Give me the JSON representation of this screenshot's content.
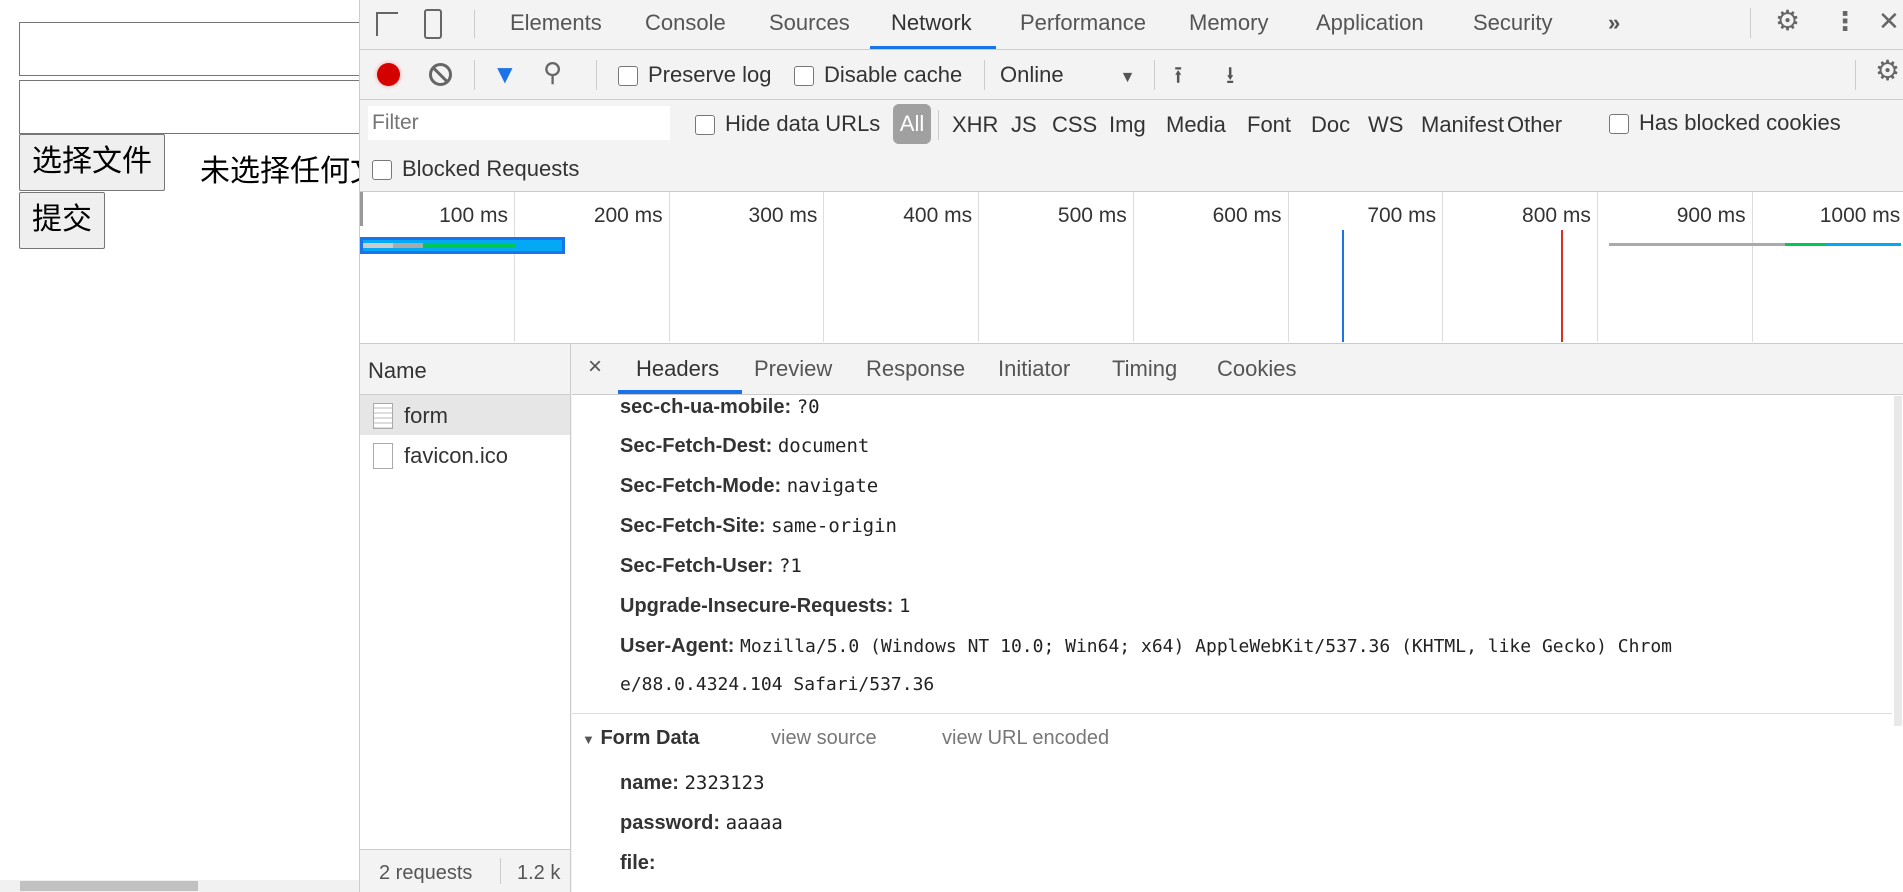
{
  "page": {
    "file_button": "选择文件",
    "file_status": "未选择任何文件",
    "submit_button": "提交"
  },
  "devtools": {
    "tabs": [
      "Elements",
      "Console",
      "Sources",
      "Network",
      "Performance",
      "Memory",
      "Application",
      "Security"
    ],
    "active_tab": "Network",
    "more_tabs": "»",
    "toolbar": {
      "preserve_log": "Preserve log",
      "disable_cache": "Disable cache",
      "throttling": "Online"
    },
    "filter": {
      "placeholder": "Filter",
      "hide_data_urls": "Hide data URLs",
      "types": [
        "All",
        "XHR",
        "JS",
        "CSS",
        "Img",
        "Media",
        "Font",
        "Doc",
        "WS",
        "Manifest",
        "Other"
      ],
      "has_blocked_cookies": "Has blocked cookies",
      "blocked_requests": "Blocked Requests"
    },
    "timeline": {
      "ticks": [
        "100 ms",
        "200 ms",
        "300 ms",
        "400 ms",
        "500 ms",
        "600 ms",
        "700 ms",
        "800 ms",
        "900 ms",
        "1000 ms"
      ],
      "dom_content_loaded_ms": 640,
      "load_ms": 781,
      "colors": {
        "dcl": "#1a73e8",
        "load": "#d93025",
        "wait": "#00c853",
        "download": "#03a9f4"
      }
    },
    "requests": {
      "header": "Name",
      "items": [
        "form",
        "favicon.ico"
      ],
      "selected": "form",
      "status": "2 requests",
      "size": "1.2 k"
    },
    "detail": {
      "close": "×",
      "tabs": [
        "Headers",
        "Preview",
        "Response",
        "Initiator",
        "Timing",
        "Cookies"
      ],
      "active_tab": "Headers",
      "headers": [
        {
          "k": "sec-ch-ua-mobile:",
          "v": "?0"
        },
        {
          "k": "Sec-Fetch-Dest:",
          "v": "document"
        },
        {
          "k": "Sec-Fetch-Mode:",
          "v": "navigate"
        },
        {
          "k": "Sec-Fetch-Site:",
          "v": "same-origin"
        },
        {
          "k": "Sec-Fetch-User:",
          "v": "?1"
        },
        {
          "k": "Upgrade-Insecure-Requests:",
          "v": "1"
        },
        {
          "k": "User-Agent:",
          "v": "Mozilla/5.0 (Windows NT 10.0; Win64; x64) AppleWebKit/537.36 (KHTML, like Gecko) Chrom",
          "v2": "e/88.0.4324.104 Safari/537.36"
        }
      ],
      "form_data": {
        "title": "Form Data",
        "view_source": "view source",
        "view_url_encoded": "view URL encoded",
        "fields": [
          {
            "k": "name:",
            "v": "2323123"
          },
          {
            "k": "password:",
            "v": "aaaaa"
          },
          {
            "k": "file:",
            "v": ""
          }
        ]
      }
    }
  }
}
